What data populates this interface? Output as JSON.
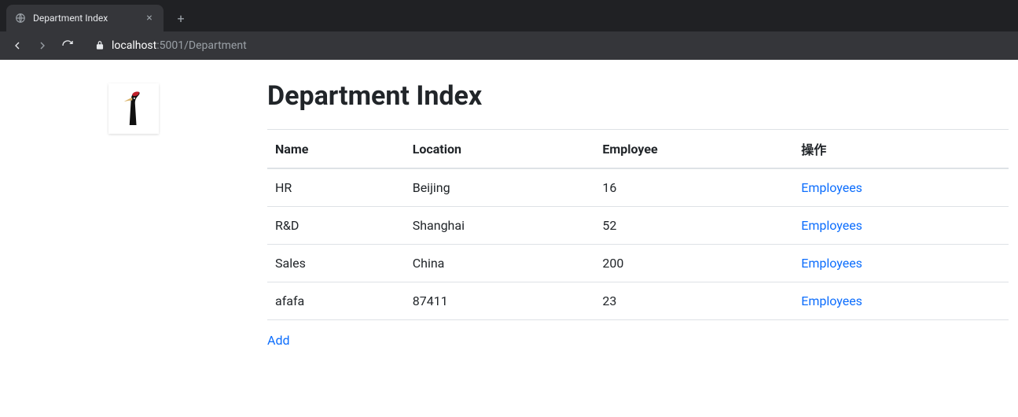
{
  "browser": {
    "tab_title": "Department Index",
    "url_host_prefix": "localhost",
    "url_host_port": ":5001",
    "url_path": "/Department"
  },
  "page": {
    "title": "Department Index",
    "add_label": "Add"
  },
  "table": {
    "headers": {
      "name": "Name",
      "location": "Location",
      "employee": "Employee",
      "action": "操作"
    },
    "action_link_label": "Employees",
    "rows": [
      {
        "name": "HR",
        "location": "Beijing",
        "employee": "16"
      },
      {
        "name": "R&D",
        "location": "Shanghai",
        "employee": "52"
      },
      {
        "name": "Sales",
        "location": "China",
        "employee": "200"
      },
      {
        "name": "afafa",
        "location": "87411",
        "employee": "23"
      }
    ]
  }
}
